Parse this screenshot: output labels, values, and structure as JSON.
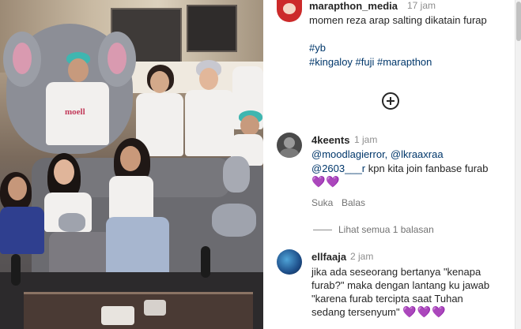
{
  "post": {
    "username": "marapthon_media",
    "time": "17 jam",
    "caption": "momen reza arap salting dikatain furap",
    "hashtags_line1": "#yb",
    "hashtags_line2": "#kingaloy #fuji #marapthon"
  },
  "media": {
    "shirt_text": "moell"
  },
  "comments": [
    {
      "username": "4keents",
      "time": "1 jam",
      "mentions": "@moodlagierror, @lkraaxraa",
      "mention3": "@2603___r",
      "text": " kpn kita join fanbase furab",
      "emoji": "💜💜",
      "like_label": "Suka",
      "reply_label": "Balas",
      "view_replies": "Lihat semua 1 balasan"
    },
    {
      "username": "ellfaaja",
      "time": "2 jam",
      "line1": "jika ada seseorang bertanya \"kenapa",
      "line2": "furab?\" maka dengan lantang ku jawab",
      "line3": "\"karena furab tercipta saat Tuhan",
      "line4": "sedang tersenyum\"",
      "emoji": "💜💜💜"
    }
  ],
  "colors": {
    "link": "#00376b",
    "muted": "#8e8e8e",
    "heart": "#7b4fc9"
  }
}
